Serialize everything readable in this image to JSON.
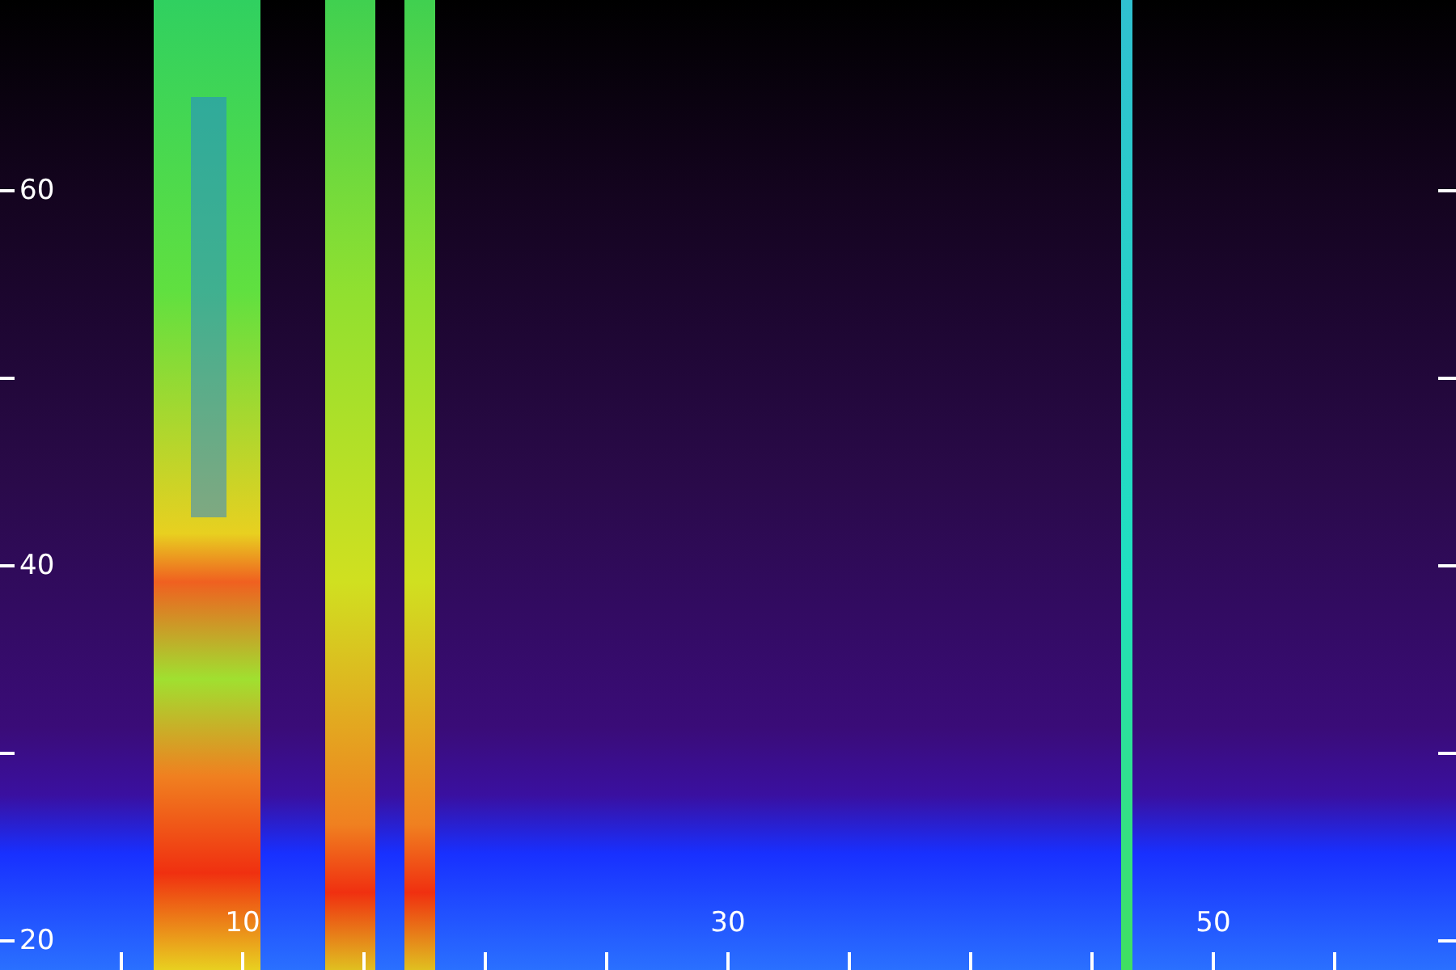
{
  "y_axis": {
    "labels": [
      "60",
      "40",
      "20"
    ]
  },
  "x_axis": {
    "labels": [
      "10",
      "30",
      "50"
    ]
  }
}
